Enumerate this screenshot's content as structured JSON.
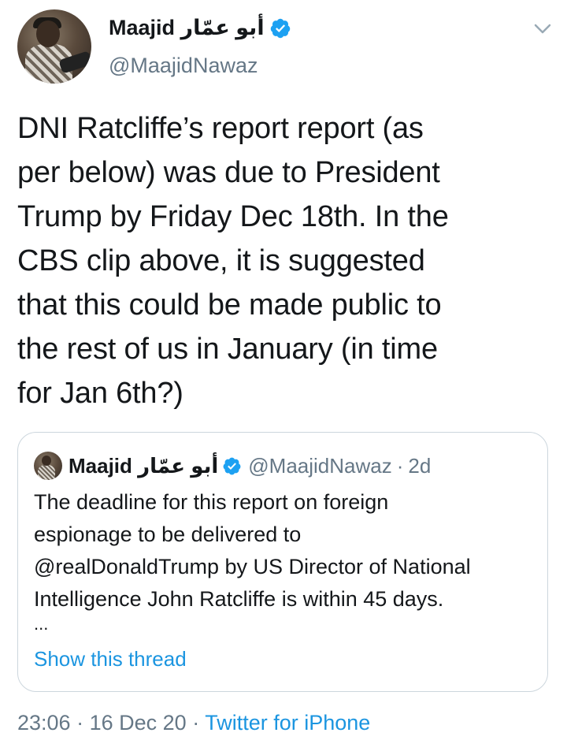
{
  "tweet": {
    "author_name": "Maajid أبو عمّار",
    "author_handle": "@MaajidNawaz",
    "verified": true,
    "text": "DNI Ratcliffe’s report report (as\nper below) was due to President\nTrump by Friday Dec 18th. In the\nCBS clip above, it is suggested\nthat this could be made public to\nthe rest of us in January (in time\nfor Jan 6th?)",
    "time": "23:06",
    "date": "16 Dec 20",
    "separator": "·",
    "source": "Twitter for iPhone",
    "menu_icon": "chevron-down-icon"
  },
  "quoted": {
    "author_name": "Maajid أبو عمّار",
    "author_handle": "@MaajidNawaz",
    "separator": "·",
    "relative_time": "2d",
    "text": "The deadline for this report on foreign\nespionage to be delivered to\n@realDonaldTrump by US Director of National\nIntelligence John Ratcliffe is within 45 days.",
    "ellipsis": "...",
    "thread_link": "Show this thread"
  },
  "colors": {
    "text": "#14171a",
    "secondary": "#657786",
    "link": "#1b95e0",
    "verified": "#1da1f2",
    "border": "#ccd6dd"
  }
}
